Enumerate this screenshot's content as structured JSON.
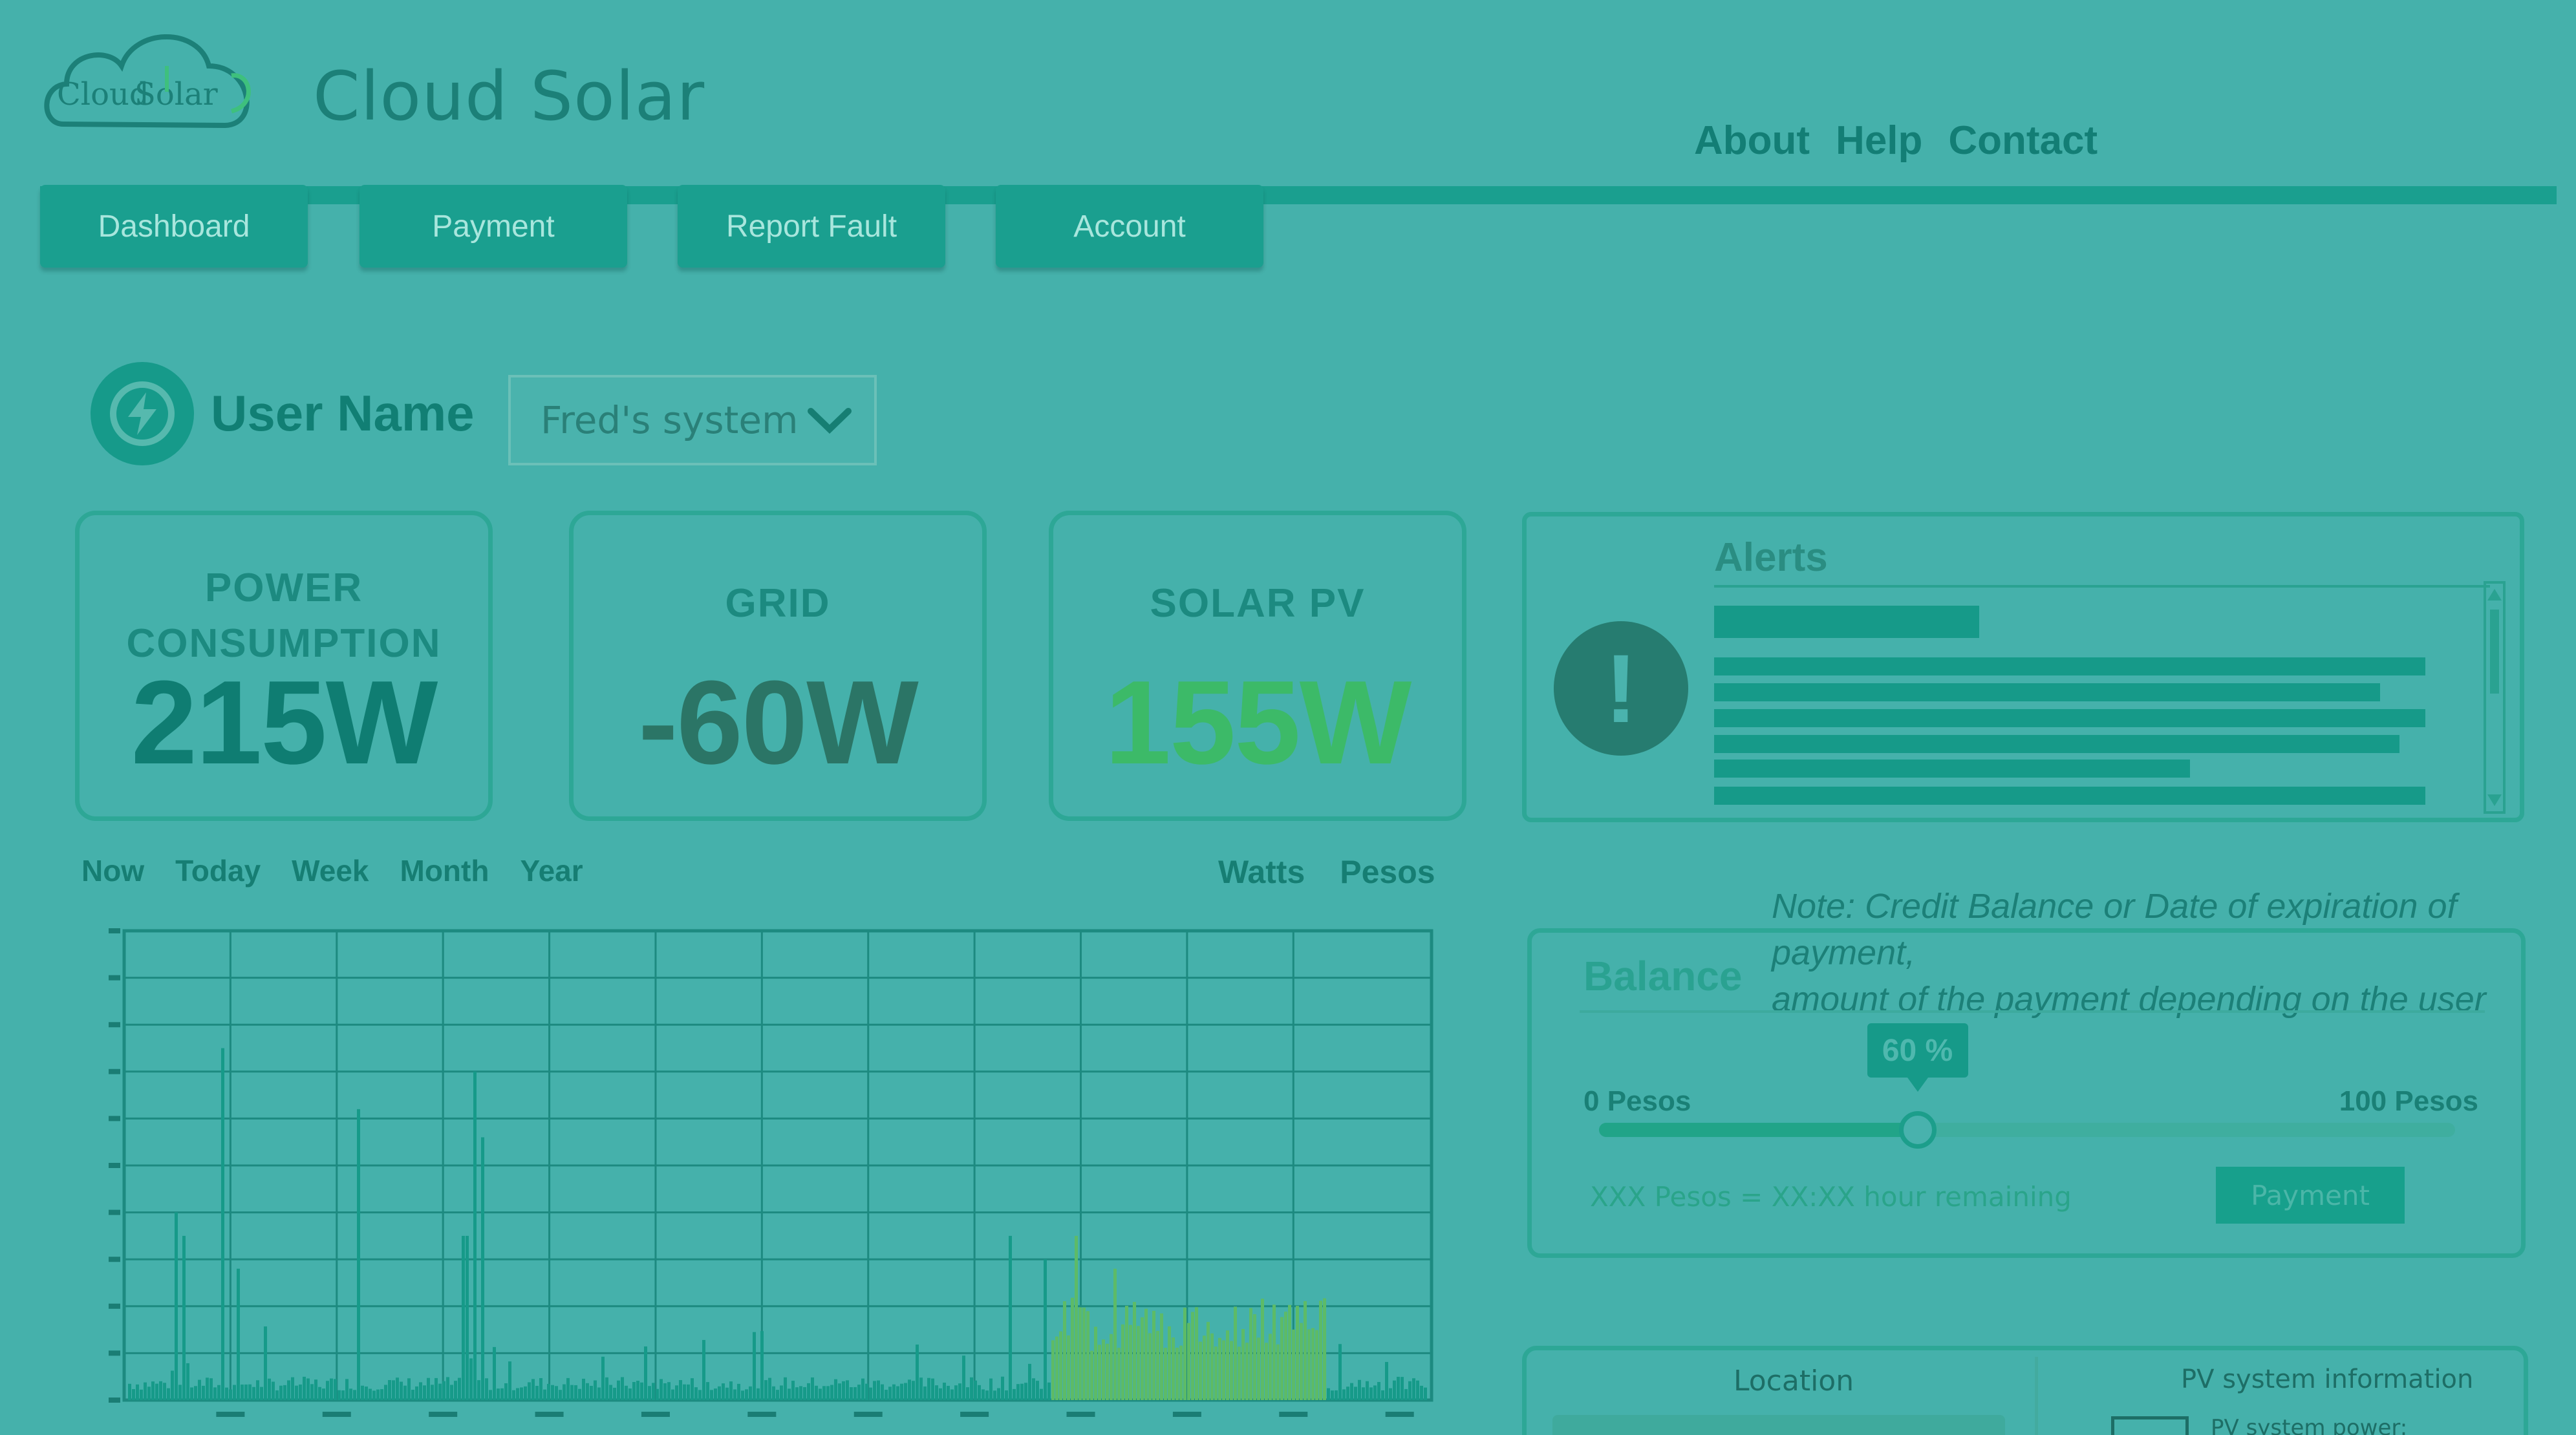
{
  "header": {
    "logo_text": "Cloud Solar",
    "app_title": "Cloud Solar",
    "links": [
      "About",
      "Help",
      "Contact"
    ]
  },
  "nav": {
    "tabs": [
      "Dashboard",
      "Payment",
      "Report Fault",
      "Account"
    ]
  },
  "user": {
    "name": "User Name",
    "system_selected": "Fred's system"
  },
  "stats": {
    "power": {
      "label_line1": "POWER",
      "label_line2": "CONSUMPTION",
      "value": "215W",
      "color": "#0f7d72"
    },
    "grid": {
      "label": "GRID",
      "value": "-60W",
      "color": "#2b7566"
    },
    "solar": {
      "label": "SOLAR PV",
      "value": "155W",
      "color": "#3cba68"
    }
  },
  "alerts": {
    "title": "Alerts"
  },
  "time_tabs": [
    "Now",
    "Today",
    "Week",
    "Month",
    "Year"
  ],
  "unit_tabs": [
    "Watts",
    "Pesos"
  ],
  "note": {
    "line1": "Note: Credit Balance or Date of expiration of payment,",
    "line2": "amount of the payment depending on the user"
  },
  "balance": {
    "title": "Balance",
    "percent_label": "60 %",
    "percent": 0.6,
    "min_label": "0 Pesos",
    "max_label": "100 Pesos",
    "remaining": "XXX Pesos = XX:XX hour remaining",
    "payment_button": "Payment"
  },
  "panels": {
    "location_title": "Location",
    "pv_title": "PV system information",
    "pv_sub": "PV system power:"
  },
  "chart_data": {
    "type": "bar",
    "series": [
      {
        "color": "#169a89"
      },
      {
        "color": "#5dbb67"
      }
    ],
    "grid": true
  }
}
